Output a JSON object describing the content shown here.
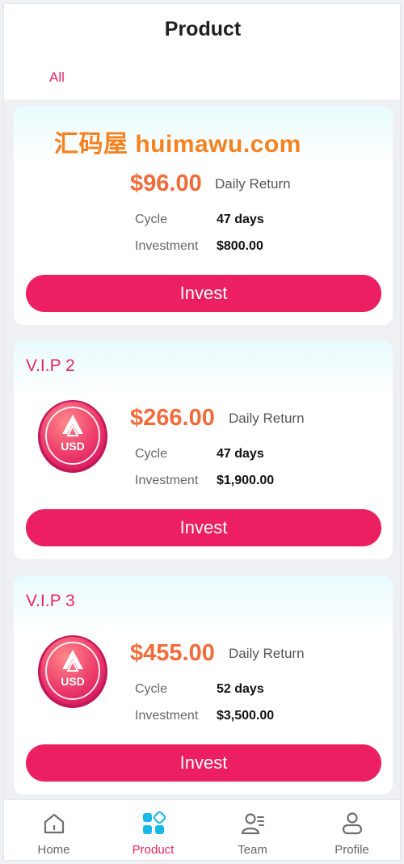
{
  "header": {
    "title": "Product"
  },
  "filter_tabs": [
    {
      "label": "All"
    }
  ],
  "watermark": "汇码屋 huimawu.com",
  "products": [
    {
      "vip": "",
      "price": "$96.00",
      "price_caption": "Daily Return",
      "cycle_label": "Cycle",
      "cycle_value": "47 days",
      "investment_label": "Investment",
      "investment_value": "$800.00",
      "button": "Invest"
    },
    {
      "vip": "V.I.P 2",
      "price": "$266.00",
      "price_caption": "Daily Return",
      "cycle_label": "Cycle",
      "cycle_value": "47 days",
      "investment_label": "Investment",
      "investment_value": "$1,900.00",
      "button": "Invest",
      "coin_text": "USD"
    },
    {
      "vip": "V.I.P 3",
      "price": "$455.00",
      "price_caption": "Daily Return",
      "cycle_label": "Cycle",
      "cycle_value": "52 days",
      "investment_label": "Investment",
      "investment_value": "$3,500.00",
      "button": "Invest",
      "coin_text": "USD"
    }
  ],
  "tabbar": {
    "items": [
      {
        "label": "Home",
        "icon": "home-icon"
      },
      {
        "label": "Product",
        "icon": "grid-icon"
      },
      {
        "label": "Team",
        "icon": "team-icon"
      },
      {
        "label": "Profile",
        "icon": "profile-icon"
      }
    ],
    "active": "Product"
  },
  "colors": {
    "accent": "#e62661",
    "button": "#eb1f62",
    "price": "#f26b3a",
    "active_icon": "#1ab7ea",
    "watermark": "#f58220"
  }
}
